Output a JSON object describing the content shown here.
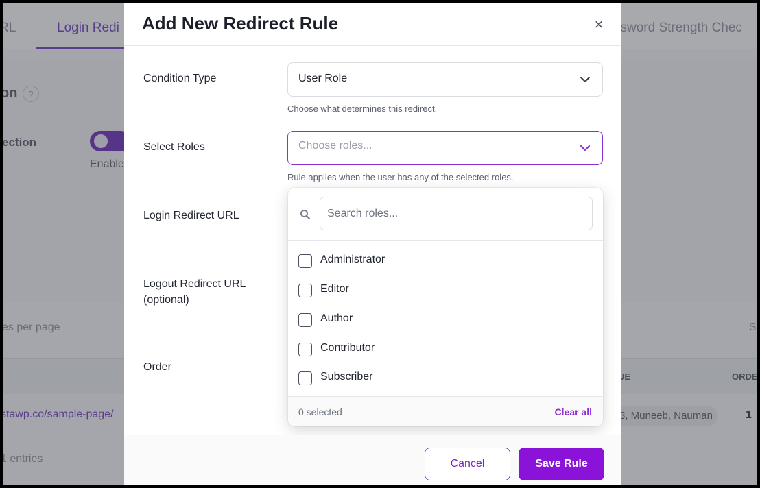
{
  "background": {
    "tabs": [
      "RL",
      "Login Redi",
      "ssword Strength Chec"
    ],
    "heading_fragment": "on",
    "help_glyph": "?",
    "setting_label_fragment": "ection",
    "toggle_caption_fragment": "Enable",
    "entries_per_page_fragment": "es per page",
    "search_fragment": "S",
    "table_headers": [
      "UE",
      "ORDE"
    ],
    "row_url_fragment": "stawp.co/sample-page/",
    "row_roles_fragment": "3, Muneeb, Nauman",
    "row_order": "1",
    "entries_fragment": "1 entries"
  },
  "modal": {
    "title": "Add New Redirect Rule",
    "close_glyph": "×",
    "fields": {
      "condition_type": {
        "label": "Condition Type",
        "value": "User Role",
        "help": "Choose what determines this redirect."
      },
      "select_roles": {
        "label": "Select Roles",
        "placeholder": "Choose roles...",
        "help": "Rule applies when the user has any of the selected roles."
      },
      "login_redirect": {
        "label": "Login Redirect URL"
      },
      "logout_redirect": {
        "label_line1": "Logout Redirect URL",
        "label_line2": "(optional)"
      },
      "order": {
        "label": "Order"
      }
    },
    "roles_dropdown": {
      "search_placeholder": "Search roles...",
      "options": [
        "Administrator",
        "Editor",
        "Author",
        "Contributor",
        "Subscriber"
      ],
      "selected_count_text": "0 selected",
      "clear_all": "Clear all"
    },
    "footer": {
      "cancel": "Cancel",
      "save": "Save Rule"
    }
  },
  "colors": {
    "accent": "#8b12d8",
    "accent_border": "#8b2fd0",
    "overlay": "#3c3e46"
  }
}
